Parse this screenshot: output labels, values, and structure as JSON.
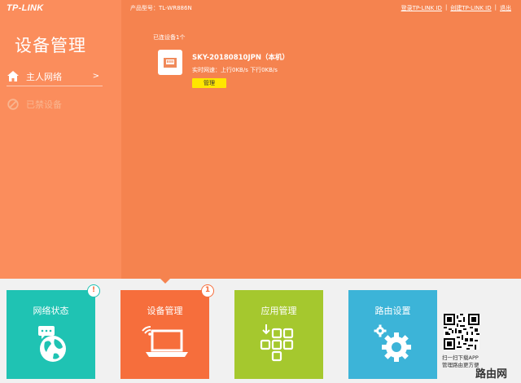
{
  "header": {
    "logo": "TP-LINK",
    "model": "产品型号：TL-WR886N",
    "login_link": "登录TP-LINK ID",
    "create_link": "创建TP-LINK ID",
    "logout": "退出",
    "separator": "|"
  },
  "sidebar": {
    "title": "设备管理",
    "items": [
      {
        "label": "主人网络",
        "icon": "home-icon",
        "arrow": ">"
      },
      {
        "label": "已禁设备",
        "icon": "block-icon"
      }
    ]
  },
  "main": {
    "connected_count": "已连设备1个",
    "device": {
      "name": "SKY-20180810JPN（本机）",
      "speed": "实时网速：上行0KB/s  下行0KB/s",
      "manage_label": "管理",
      "icon": "ethernet-port-icon"
    }
  },
  "tiles": [
    {
      "label": "网络状态",
      "icon": "globe-chat-icon",
      "badge": "!",
      "color": "#1fc3b3"
    },
    {
      "label": "设备管理",
      "icon": "laptop-wifi-icon",
      "badge": "1",
      "color": "#f66e3c"
    },
    {
      "label": "应用管理",
      "icon": "apps-grid-icon",
      "color": "#a5c82e"
    },
    {
      "label": "路由设置",
      "icon": "gear-icon",
      "color": "#3cb4d8"
    }
  ],
  "qr": {
    "caption_line1": "扫一扫下载APP",
    "caption_line2": "管理路由更方便"
  },
  "watermark": "路由网",
  "colors": {
    "top_bg": "#f5834f",
    "sidebar_bg": "#fb8d5c",
    "manage_button": "#ffe600"
  }
}
